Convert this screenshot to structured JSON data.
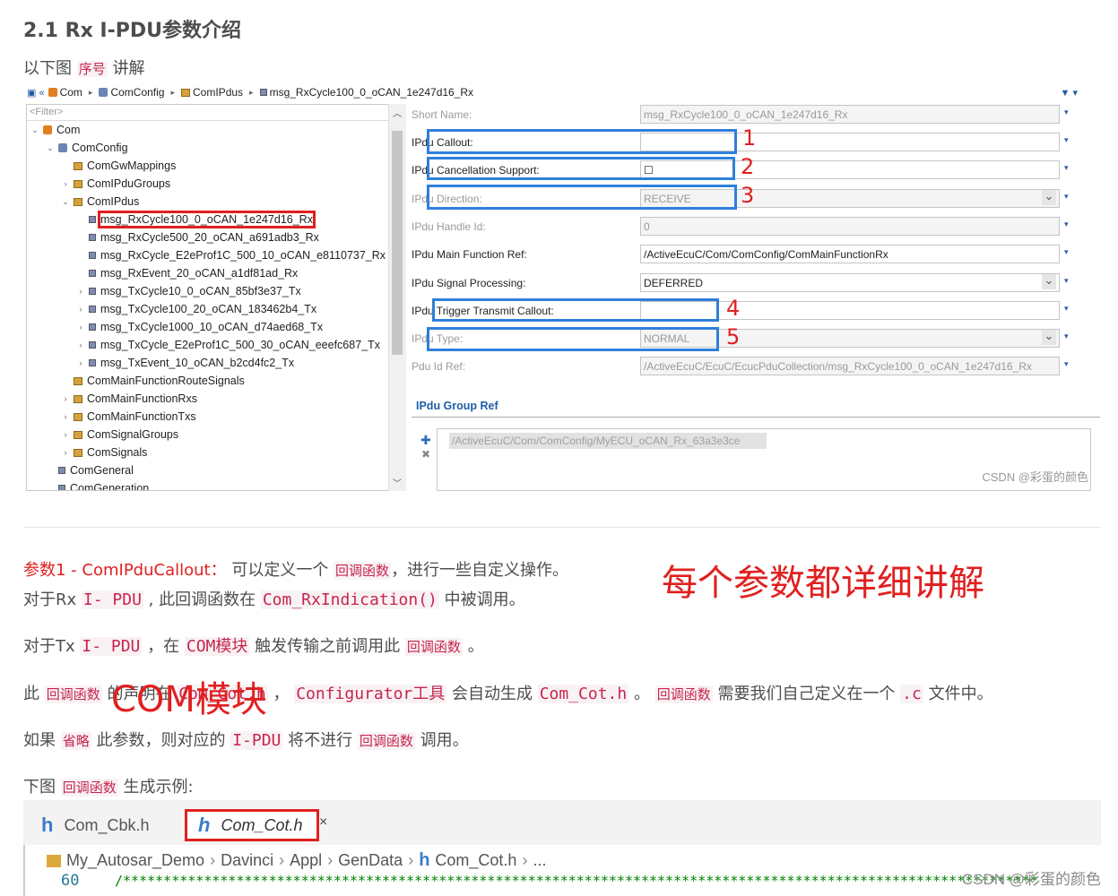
{
  "heading": "2.1 Rx I-PDU参数介绍",
  "intro": {
    "pre": "以下图 ",
    "hl": "序号",
    "post": " 讲解"
  },
  "eclipse": {
    "breadcrumb": [
      "Com",
      "ComConfig",
      "ComIPdus",
      "msg_RxCycle100_0_oCAN_1e247d16_Rx"
    ],
    "filter_placeholder": "<Filter>",
    "tree": [
      {
        "level": 0,
        "twisty": "⌄",
        "icon": "com",
        "label": "Com"
      },
      {
        "level": 1,
        "twisty": "⌄",
        "icon": "cfg",
        "label": "ComConfig"
      },
      {
        "level": 2,
        "twisty": "",
        "icon": "pkg",
        "label": "ComGwMappings"
      },
      {
        "level": 2,
        "twisty": "›",
        "icon": "pkg",
        "label": "ComIPduGroups"
      },
      {
        "level": 2,
        "twisty": "⌄",
        "icon": "pkg",
        "label": "ComIPdus"
      },
      {
        "level": 3,
        "twisty": "",
        "icon": "doc",
        "label": "msg_RxCycle100_0_oCAN_1e247d16_Rx",
        "selected": true
      },
      {
        "level": 3,
        "twisty": "",
        "icon": "doc",
        "label": "msg_RxCycle500_20_oCAN_a691adb3_Rx"
      },
      {
        "level": 3,
        "twisty": "",
        "icon": "doc",
        "label": "msg_RxCycle_E2eProf1C_500_10_oCAN_e8110737_Rx"
      },
      {
        "level": 3,
        "twisty": "",
        "icon": "doc",
        "label": "msg_RxEvent_20_oCAN_a1df81ad_Rx"
      },
      {
        "level": 3,
        "twisty": "›",
        "icon": "doc",
        "label": "msg_TxCycle10_0_oCAN_85bf3e37_Tx"
      },
      {
        "level": 3,
        "twisty": "›",
        "icon": "doc",
        "label": "msg_TxCycle100_20_oCAN_183462b4_Tx"
      },
      {
        "level": 3,
        "twisty": "›",
        "icon": "doc",
        "label": "msg_TxCycle1000_10_oCAN_d74aed68_Tx"
      },
      {
        "level": 3,
        "twisty": "›",
        "icon": "doc",
        "label": "msg_TxCycle_E2eProf1C_500_30_oCAN_eeefc687_Tx"
      },
      {
        "level": 3,
        "twisty": "›",
        "icon": "doc",
        "label": "msg_TxEvent_10_oCAN_b2cd4fc2_Tx"
      },
      {
        "level": 2,
        "twisty": "",
        "icon": "pkg",
        "label": "ComMainFunctionRouteSignals"
      },
      {
        "level": 2,
        "twisty": "›",
        "icon": "pkg",
        "label": "ComMainFunctionRxs"
      },
      {
        "level": 2,
        "twisty": "›",
        "icon": "pkg",
        "label": "ComMainFunctionTxs"
      },
      {
        "level": 2,
        "twisty": "›",
        "icon": "pkg",
        "label": "ComSignalGroups"
      },
      {
        "level": 2,
        "twisty": "›",
        "icon": "pkg",
        "label": "ComSignals"
      },
      {
        "level": 1,
        "twisty": "",
        "icon": "doc",
        "label": "ComGeneral"
      },
      {
        "level": 1,
        "twisty": "",
        "icon": "doc",
        "label": "ComGeneration"
      }
    ],
    "props": [
      {
        "label": "Short Name:",
        "value": "msg_RxCycle100_0_oCAN_1e247d16_Rx",
        "disabled": true,
        "combo": false
      },
      {
        "label": "IPdu Callout:",
        "value": "",
        "disabled": false,
        "combo": false
      },
      {
        "label": "IPdu Cancellation Support:",
        "value": "☐",
        "disabled": false,
        "combo": false
      },
      {
        "label": "IPdu Direction:",
        "value": "RECEIVE",
        "disabled": true,
        "combo": true
      },
      {
        "label": "IPdu Handle Id:",
        "value": "0",
        "disabled": true,
        "combo": false
      },
      {
        "label": "IPdu Main Function Ref:",
        "value": "/ActiveEcuC/Com/ComConfig/ComMainFunctionRx",
        "disabled": false,
        "combo": false
      },
      {
        "label": "IPdu Signal Processing:",
        "value": "DEFERRED",
        "disabled": false,
        "combo": true
      },
      {
        "label": "IPdu Trigger Transmit Callout:",
        "value": "",
        "disabled": false,
        "combo": false
      },
      {
        "label": "IPdu Type:",
        "value": "NORMAL",
        "disabled": true,
        "combo": true
      },
      {
        "label": "Pdu Id Ref:",
        "value": "/ActiveEcuC/EcuC/EcucPduCollection/msg_RxCycle100_0_oCAN_1e247d16_Rx",
        "disabled": true,
        "combo": false
      }
    ],
    "markers": [
      "1",
      "2",
      "3",
      "4",
      "5"
    ],
    "group_title": "IPdu Group Ref",
    "group_item": "/ActiveEcuC/Com/ComConfig/MyECU_oCAN_Rx_63a3e3ce",
    "watermark": "CSDN @彩蛋的颜色"
  },
  "annotation_big": "每个参数都详细讲解",
  "annotation_com": "COM模块",
  "p1": {
    "param": "参数1 - ComIPduCallout：",
    "t1": " 可以定义一个 ",
    "hl1": "回调函数",
    "t2": "，进行一些自定义操作。"
  },
  "p2": {
    "t1": "对于Rx ",
    "hl1": "I- PDU",
    "t2": " , 此回调函数在 ",
    "hl2": "Com_RxIndication()",
    "t3": " 中被调用。"
  },
  "p3": {
    "t1": "对于Tx ",
    "hl1": "I- PDU",
    "t2": " ，在 ",
    "hl2": "COM模块",
    "t3": " 触发传输之前调用此 ",
    "hl3": "回调函数",
    "t4": " 。"
  },
  "p4": {
    "t1": "此 ",
    "hl1": "回调函数",
    "t2": " 的声明在 ",
    "hl2": "Com_Cot.h",
    "t3": " ， ",
    "hl3": "Configurator工具",
    "t4": " 会自动生成 ",
    "hl4": "Com_Cot.h",
    "t5": " 。 ",
    "hl5": "回调函数",
    "t6": " 需要我们自己定义在一个 ",
    "hl6": ".c",
    "t7": " 文件中。"
  },
  "p5": {
    "t1": "如果 ",
    "hl1": "省略",
    "t2": " 此参数，则对应的 ",
    "hl2": "I-PDU",
    "t3": " 将不进行 ",
    "hl3": "回调函数",
    "t4": " 调用。"
  },
  "p6": {
    "t1": "下图 ",
    "hl1": "回调函数",
    "t2": " 生成示例:"
  },
  "vscode": {
    "tab1": "Com_Cbk.h",
    "tab2": "Com_Cot.h",
    "tab_close": "×",
    "file_glyph": "h",
    "breadcrumb": [
      "My_Autosar_Demo",
      "Davinci",
      "Appl",
      "GenData",
      "Com_Cot.h",
      "..."
    ],
    "line_no": "60",
    "comment": "/**********************************************************************************************************************",
    "watermark": "CSDN @彩蛋的颜色"
  }
}
